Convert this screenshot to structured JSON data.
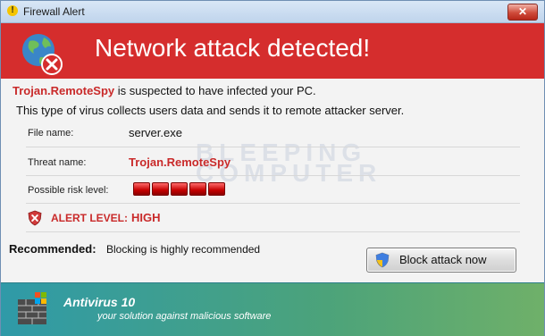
{
  "window": {
    "title": "Firewall Alert",
    "close_glyph": "✕",
    "title_icon_glyph": "!"
  },
  "header": {
    "headline": "Network attack detected!",
    "icon": "globe-x-icon"
  },
  "message": {
    "threat_name": "Trojan.RemoteSpy",
    "suspected_text": "is suspected to have infected your PC.",
    "description": "This type of virus collects users data and sends it to remote attacker server."
  },
  "details": {
    "file_label": "File name:",
    "file_value": "server.exe",
    "threat_label": "Threat name:",
    "threat_value": "Trojan.RemoteSpy",
    "risk_label": "Possible risk level:",
    "risk_level": 5,
    "risk_max": 5,
    "alert_label": "ALERT LEVEL:",
    "alert_value": "HIGH"
  },
  "recommendation": {
    "label": "Recommended:",
    "text": "Blocking is highly recommended"
  },
  "button": {
    "label": "Block attack now"
  },
  "watermark": {
    "line1": "BLEEPING",
    "line2": "COMPUTER"
  },
  "footer": {
    "product": "Antivirus 10",
    "tagline": "your solution against malicious software"
  },
  "colors": {
    "accent": "#d52d2d",
    "alert_text": "#c92a2a",
    "footer_start": "#2f9aa8",
    "footer_end": "#6fb069"
  }
}
